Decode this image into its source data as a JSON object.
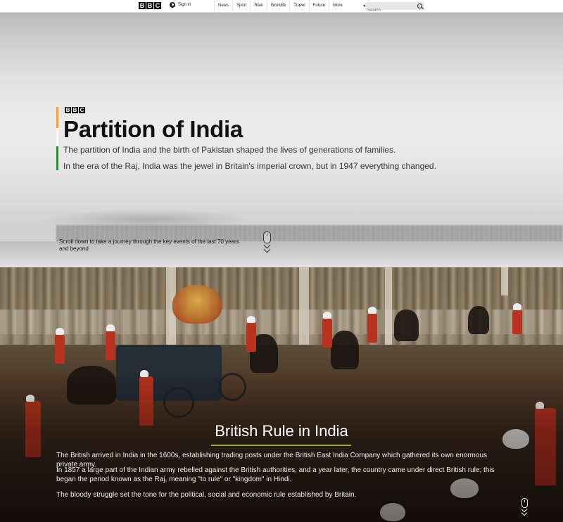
{
  "nav": {
    "logo_letters": [
      "B",
      "B",
      "C"
    ],
    "signin": "Sign in",
    "links": [
      "News",
      "Sport",
      "Reel",
      "Worklife",
      "Travel",
      "Future"
    ],
    "more": "More",
    "search_placeholder": "Search"
  },
  "hero": {
    "logo_letters": [
      "B",
      "B",
      "C"
    ],
    "title": "Partition of India",
    "para1": "The partition of India and the birth of Pakistan shaped the lives of generations of families.",
    "para2": "In the era of the Raj, India was the jewel in Britain's imperial crown, but in 1947 everything changed.",
    "scroll_text": "Scroll down to take a journey through the key events of the last 70 years and beyond",
    "accent_colors": [
      "#f0a33a",
      "#fafafa",
      "#2f8a2f"
    ]
  },
  "british_rule": {
    "title": "British Rule in India",
    "rule_color": "#9aaa3a",
    "para1": "The British arrived in India in the 1600s, establishing trading posts under the British East India Company which gathered its own enormous private army.",
    "para2": "In 1857 a large part of the Indian army rebelled against the British authorities, and a year later, the country came under direct British rule; this began the period known as the Raj, meaning \"to rule\" or \"kingdom\" in Hindi.",
    "para3": "The bloody struggle set the tone for the political, social and economic rule established by Britain."
  }
}
